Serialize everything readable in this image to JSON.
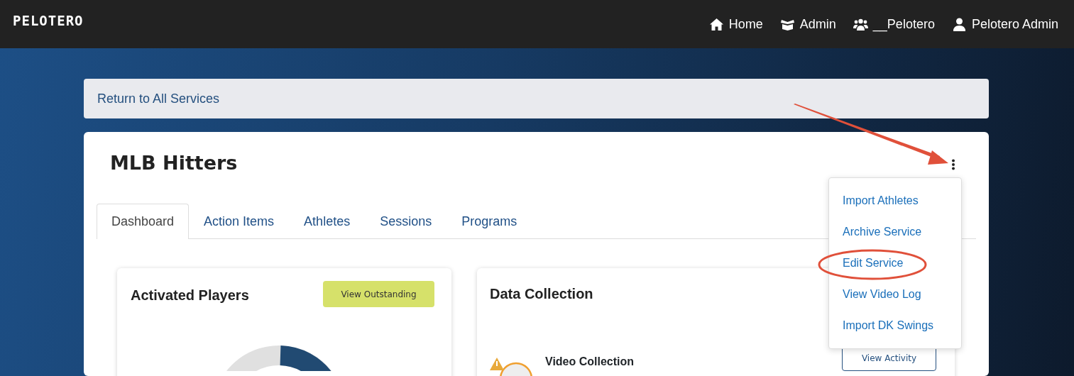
{
  "brand": "PELOTERO",
  "nav": [
    {
      "label": "Home"
    },
    {
      "label": "Admin"
    },
    {
      "label": "__Pelotero"
    },
    {
      "label": "Pelotero Admin"
    }
  ],
  "breadcrumb": "Return to All Services",
  "service": {
    "title": "MLB Hitters"
  },
  "tabs": [
    {
      "label": "Dashboard",
      "selected": true
    },
    {
      "label": "Action Items",
      "selected": false
    },
    {
      "label": "Athletes",
      "selected": false
    },
    {
      "label": "Sessions",
      "selected": false
    },
    {
      "label": "Programs",
      "selected": false
    }
  ],
  "menu": [
    {
      "label": "Import Athletes"
    },
    {
      "label": "Archive Service"
    },
    {
      "label": "Edit Service"
    },
    {
      "label": "View Video Log"
    },
    {
      "label": "Import DK Swings"
    }
  ],
  "cards": [
    {
      "kind": "donut",
      "title": "Activated Players",
      "button": "View Outstanding"
    },
    {
      "kind": "list",
      "title": "Data Collection",
      "rows": [
        {
          "title": "Video Collection",
          "button": "View Activity"
        }
      ]
    }
  ]
}
